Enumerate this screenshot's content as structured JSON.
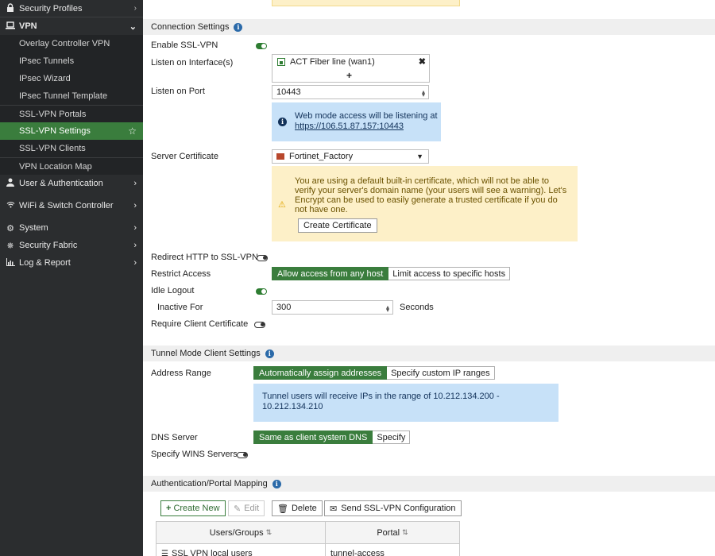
{
  "sidebar": {
    "security_profiles": "Security Profiles",
    "vpn": "VPN",
    "vpn_items": [
      "Overlay Controller VPN",
      "IPsec Tunnels",
      "IPsec Wizard",
      "IPsec Tunnel Template",
      "SSL-VPN Portals",
      "SSL-VPN Settings",
      "SSL-VPN Clients",
      "VPN Location Map"
    ],
    "user_auth": "User & Authentication",
    "wifi_switch": "WiFi & Switch Controller",
    "system": "System",
    "security_fabric": "Security Fabric",
    "log_report": "Log & Report"
  },
  "connection": {
    "title": "Connection Settings",
    "enable_ssl_label": "Enable SSL-VPN",
    "listen_iface_label": "Listen on Interface(s)",
    "iface_value": "ACT Fiber line (wan1)",
    "add_symbol": "+",
    "listen_port_label": "Listen on Port",
    "port_value": "10443",
    "web_mode_note": "Web mode access will be listening at",
    "web_mode_url": "https://106.51.87.157:10443",
    "server_cert_label": "Server Certificate",
    "cert_value": "Fortinet_Factory",
    "cert_warning": "You are using a default built-in certificate, which will not be able to verify your server's domain name (your users will see a warning). Let's Encrypt can be used to easily generate a trusted certificate if you do not have one.",
    "create_cert_button": "Create Certificate",
    "redirect_label": "Redirect HTTP to SSL-VPN",
    "restrict_label": "Restrict Access",
    "restrict_opt1": "Allow access from any host",
    "restrict_opt2": "Limit access to specific hosts",
    "idle_label": "Idle Logout",
    "inactive_label": "Inactive For",
    "inactive_value": "300",
    "seconds": "Seconds",
    "client_cert_label": "Require Client Certificate"
  },
  "tunnel": {
    "title": "Tunnel Mode Client Settings",
    "address_label": "Address Range",
    "addr_opt1": "Automatically assign addresses",
    "addr_opt2": "Specify custom IP ranges",
    "addr_note": "Tunnel users will receive IPs in the range of 10.212.134.200 - 10.212.134.210",
    "dns_label": "DNS Server",
    "dns_opt1": "Same as client system DNS",
    "dns_opt2": "Specify",
    "wins_label": "Specify WINS Servers"
  },
  "mapping": {
    "title": "Authentication/Portal Mapping",
    "create_new": "Create New",
    "edit": "Edit",
    "delete": "Delete",
    "send_config": "Send SSL-VPN Configuration",
    "col_users": "Users/Groups",
    "col_portal": "Portal",
    "rows": [
      {
        "user": "SSL VPN local users",
        "portal": "tunnel-access"
      }
    ]
  },
  "colors": {
    "accent_green": "#3a7d3d",
    "info_blue": "#c7e1f8",
    "warn_yellow": "#fdf0c8",
    "sidebar_bg": "#2b2d2f"
  }
}
